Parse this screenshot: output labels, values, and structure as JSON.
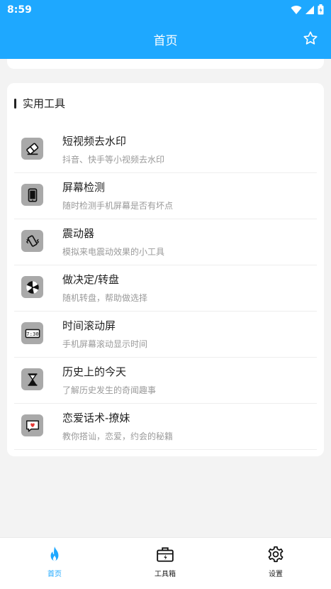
{
  "status": {
    "time": "8:59"
  },
  "appbar": {
    "title": "首页"
  },
  "section": {
    "title": "实用工具"
  },
  "tools": [
    {
      "icon": "eraser-icon",
      "title": "短视频去水印",
      "subtitle": "抖音、快手等小视频去水印"
    },
    {
      "icon": "phone-icon",
      "title": "屏幕检测",
      "subtitle": "随时检测手机屏幕是否有坏点"
    },
    {
      "icon": "vibrate-icon",
      "title": "震动器",
      "subtitle": "模拟来电震动效果的小工具"
    },
    {
      "icon": "wheel-icon",
      "title": "做决定/转盘",
      "subtitle": "随机转盘，帮助做选择"
    },
    {
      "icon": "clock-display-icon",
      "title": "时间滚动屏",
      "subtitle": "手机屏幕滚动显示时间",
      "icon_text": "7:30"
    },
    {
      "icon": "hourglass-icon",
      "title": "历史上的今天",
      "subtitle": "了解历史发生的奇闻趣事"
    },
    {
      "icon": "heart-message-icon",
      "title": "恋爱话术-撩妹",
      "subtitle": "教你搭讪，恋爱，约会的秘籍"
    }
  ],
  "nav": [
    {
      "label": "首页",
      "icon": "flame-icon",
      "active": true
    },
    {
      "label": "工具箱",
      "icon": "toolbox-icon",
      "active": false
    },
    {
      "label": "设置",
      "icon": "gear-icon",
      "active": false
    }
  ],
  "colors": {
    "primary": "#1ea8ff",
    "icon_bg": "#a9a9a9"
  }
}
